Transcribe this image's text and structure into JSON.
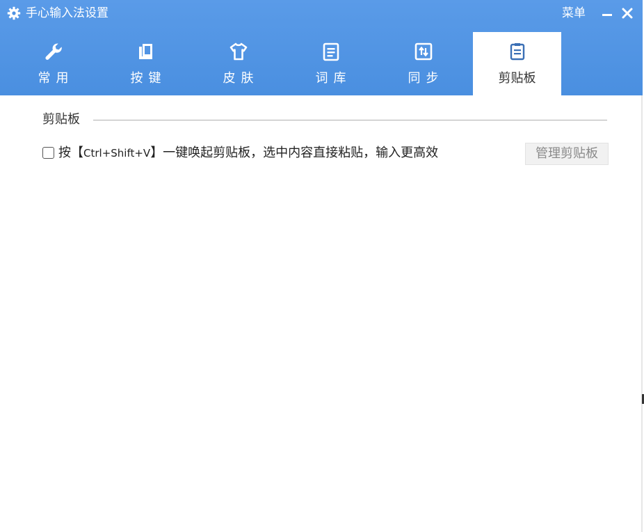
{
  "window": {
    "title": "手心输入法设置",
    "menu_label": "菜单",
    "accent_color": "#4a90e2"
  },
  "tabs": [
    {
      "label": "常用",
      "icon": "wrench-icon",
      "active": false
    },
    {
      "label": "按键",
      "icon": "keyboard-key-icon",
      "active": false
    },
    {
      "label": "皮肤",
      "icon": "tshirt-icon",
      "active": false
    },
    {
      "label": "词库",
      "icon": "document-icon",
      "active": false
    },
    {
      "label": "同步",
      "icon": "sync-icon",
      "active": false
    },
    {
      "label": "剪贴板",
      "icon": "clipboard-icon",
      "active": true
    }
  ],
  "clipboard_section": {
    "title": "剪贴板",
    "option_prefix": "按【",
    "option_key": "Ctrl+Shift+V",
    "option_suffix": "】一键唤起剪贴板，选中内容直接粘贴，输入更高效",
    "option_checked": false,
    "manage_button_label": "管理剪贴板"
  }
}
